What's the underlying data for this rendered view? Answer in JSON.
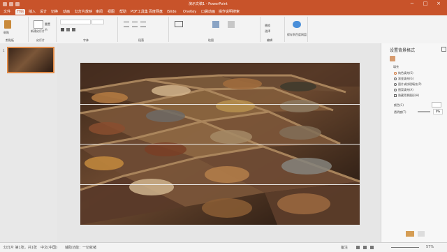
{
  "window": {
    "title": "演示文稿1 - PowerPoint",
    "colors": {
      "brand": "#c8532a",
      "ribbon": "#f3f3f3",
      "panel": "#f7f7f7",
      "accent": "#e08a47"
    },
    "controls": {
      "minimize": "−",
      "maximize": "□",
      "close": "×"
    }
  },
  "tabs": {
    "items": [
      "文件",
      "开始",
      "插入",
      "设计",
      "切换",
      "动画",
      "幻灯片放映",
      "审阅",
      "视图",
      "帮助",
      "PDF工具集",
      "百度网盘",
      "iSlide",
      "OneKey",
      "口袋动画",
      "操作说明搜索"
    ],
    "active": "开始"
  },
  "ribbon": {
    "groups": [
      "剪贴板",
      "幻灯片",
      "字体",
      "段落",
      "绘图",
      "编辑",
      "保存到百度网盘"
    ],
    "font_name": "",
    "font_size": "",
    "buttons": [
      "粘贴",
      "新建幻灯片",
      "重置",
      "节",
      "替换",
      "选择"
    ]
  },
  "slide_panel": {
    "slide_number": "1"
  },
  "right_panel": {
    "title": "设置背景格式",
    "section": "填充",
    "options": [
      "纯色填充(S)",
      "渐变填充(G)",
      "图片或纹理填充(P)",
      "图案填充(A)",
      "隐藏背景图形(H)"
    ],
    "color_label": "颜色(C)",
    "transparency_label": "透明度(T)",
    "transparency_value": "0%"
  },
  "status": {
    "slide": "幻灯片 第1张，共1张",
    "language": "中文(中国)",
    "accessibility": "辅助功能：一切就绪",
    "notes": "备注",
    "zoom": "57%"
  },
  "slide_content": {
    "image_icon": "spice-drawer-image",
    "horizontal_lines": 3
  }
}
